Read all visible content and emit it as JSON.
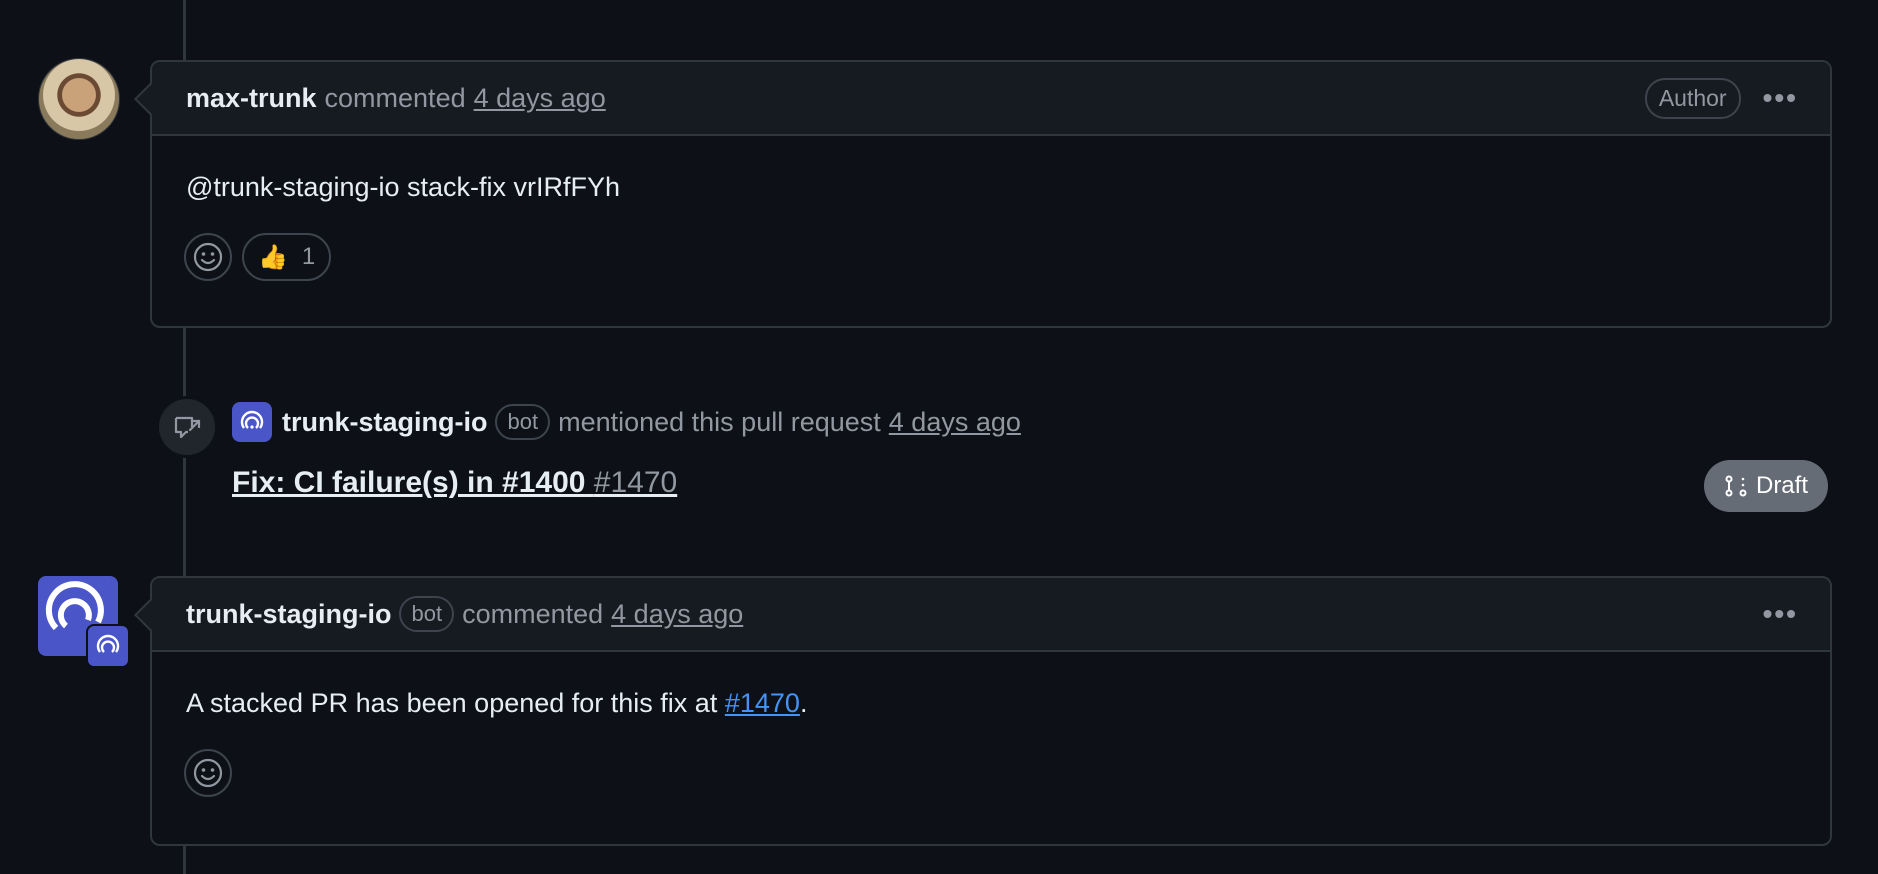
{
  "comment1": {
    "username": "max-trunk",
    "action": "commented",
    "time": "4 days ago",
    "author_badge": "Author",
    "body": "@trunk-staging-io stack-fix vrIRfFYh",
    "reactions": [
      {
        "emoji": "👍",
        "count": "1"
      }
    ],
    "icons": {
      "avatar": "user-photo",
      "kebab": "kebab-horizontal-icon",
      "smiley": "smiley-icon"
    }
  },
  "event": {
    "username": "trunk-staging-io",
    "bot_label": "bot",
    "action": "mentioned this pull request",
    "time": "4 days ago",
    "pr_title": "Fix: CI failure(s) in #1400",
    "pr_number": "#1470",
    "draft_label": "Draft",
    "icons": {
      "event": "cross-reference-icon",
      "draft": "git-pull-request-draft-icon"
    }
  },
  "comment2": {
    "username": "trunk-staging-io",
    "bot_label": "bot",
    "action": "commented",
    "time": "4 days ago",
    "body_prefix": "A stacked PR has been opened for this fix at",
    "body_link": "#1470",
    "body_suffix": ".",
    "icons": {
      "avatar": "trunk-logo-icon",
      "kebab": "kebab-horizontal-icon",
      "smiley": "smiley-icon"
    }
  },
  "colors": {
    "background": "#0d1117",
    "header": "#161b22",
    "border": "#30363d",
    "link": "#4493f8",
    "bot_avatar": "#4a56c8",
    "draft": "#656c76"
  }
}
